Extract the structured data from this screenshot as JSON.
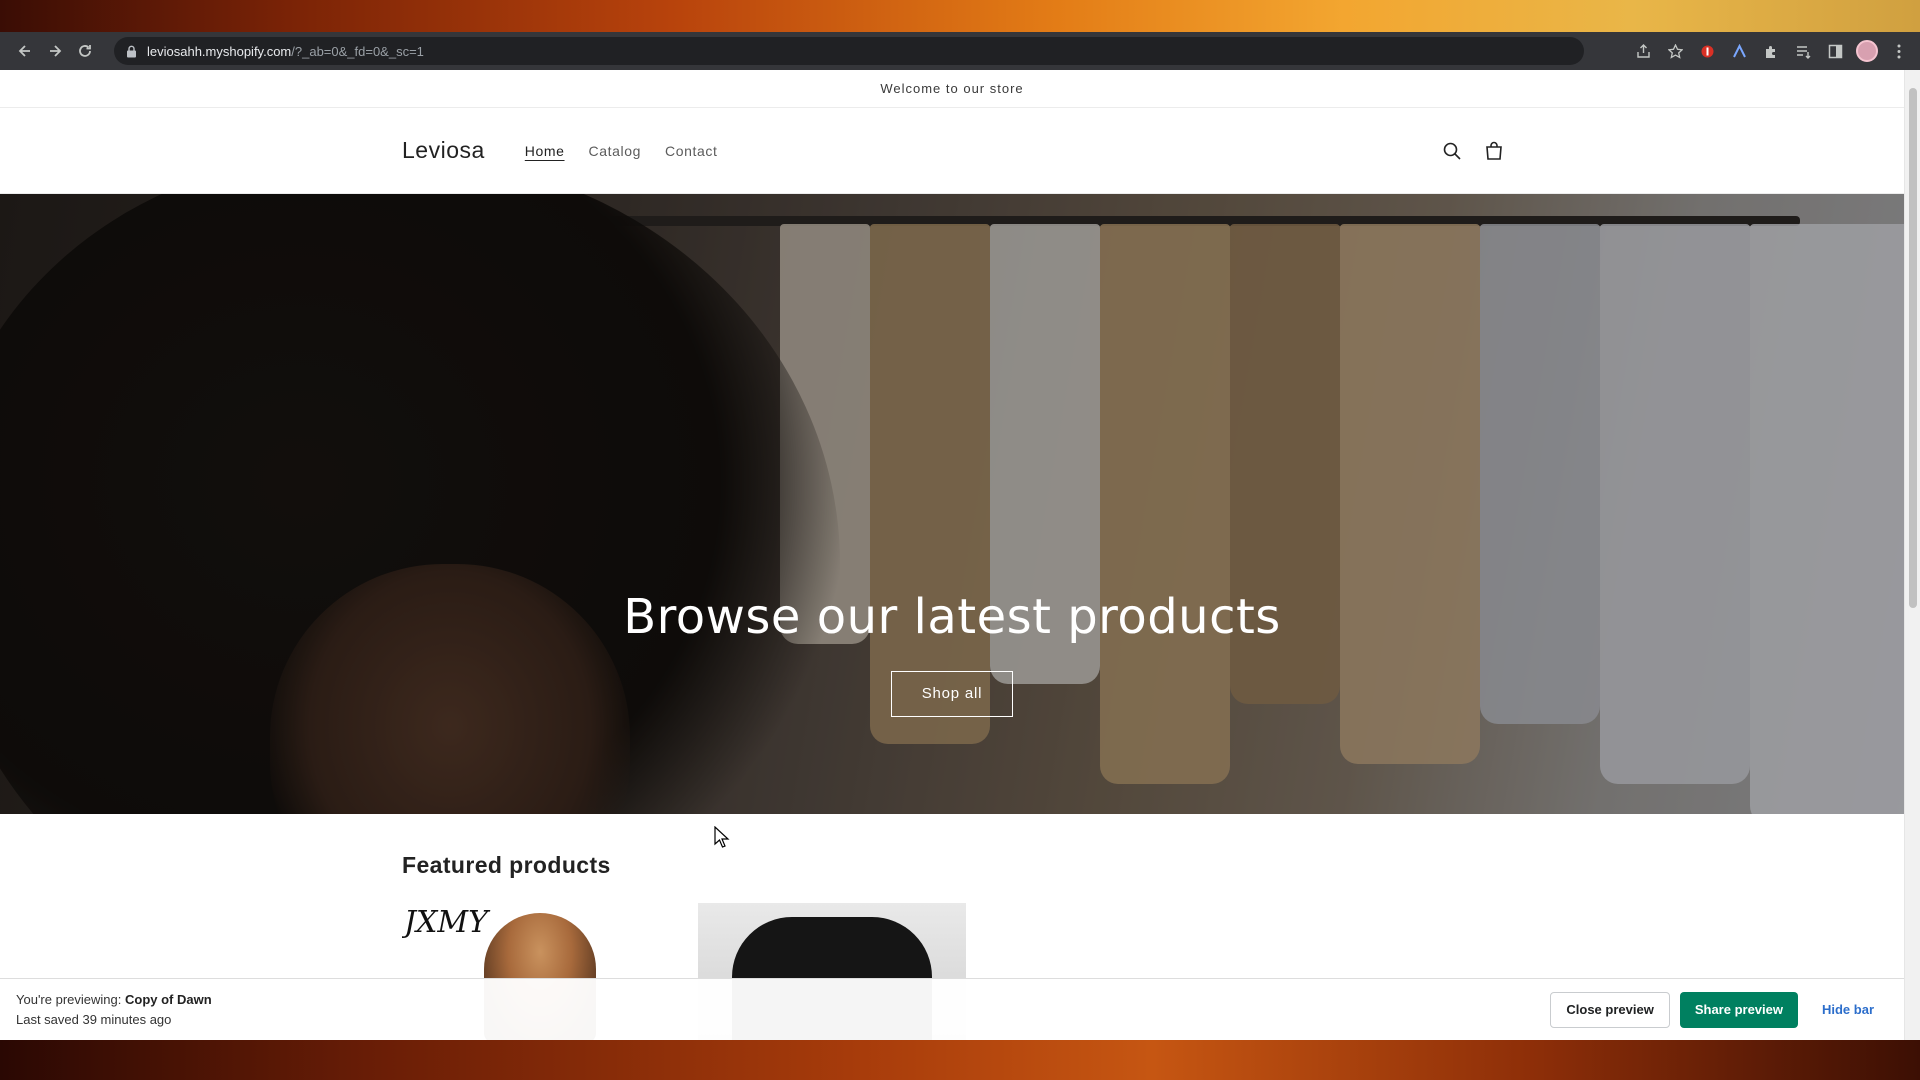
{
  "browser": {
    "url_host": "leviosahh.myshopify.com",
    "url_path": "/?_ab=0&_fd=0&_sc=1"
  },
  "store": {
    "announcement": "Welcome to our store",
    "logo": "Leviosa",
    "nav": [
      {
        "label": "Home",
        "active": true
      },
      {
        "label": "Catalog",
        "active": false
      },
      {
        "label": "Contact",
        "active": false
      }
    ]
  },
  "hero": {
    "title": "Browse our latest products",
    "button": "Shop all"
  },
  "featured": {
    "title": "Featured products",
    "products": [
      {
        "brand_text": "JXMY"
      },
      {
        "brand_text": ""
      }
    ]
  },
  "preview_bar": {
    "previewing_prefix": "You're previewing:",
    "theme_name": "Copy of Dawn",
    "last_saved": "Last saved 39 minutes ago",
    "close_label": "Close preview",
    "share_label": "Share preview",
    "hide_label": "Hide bar"
  },
  "colors": {
    "share_button": "#008060",
    "hide_link": "#2c6ecb",
    "browser_toolbar": "#35363a"
  }
}
